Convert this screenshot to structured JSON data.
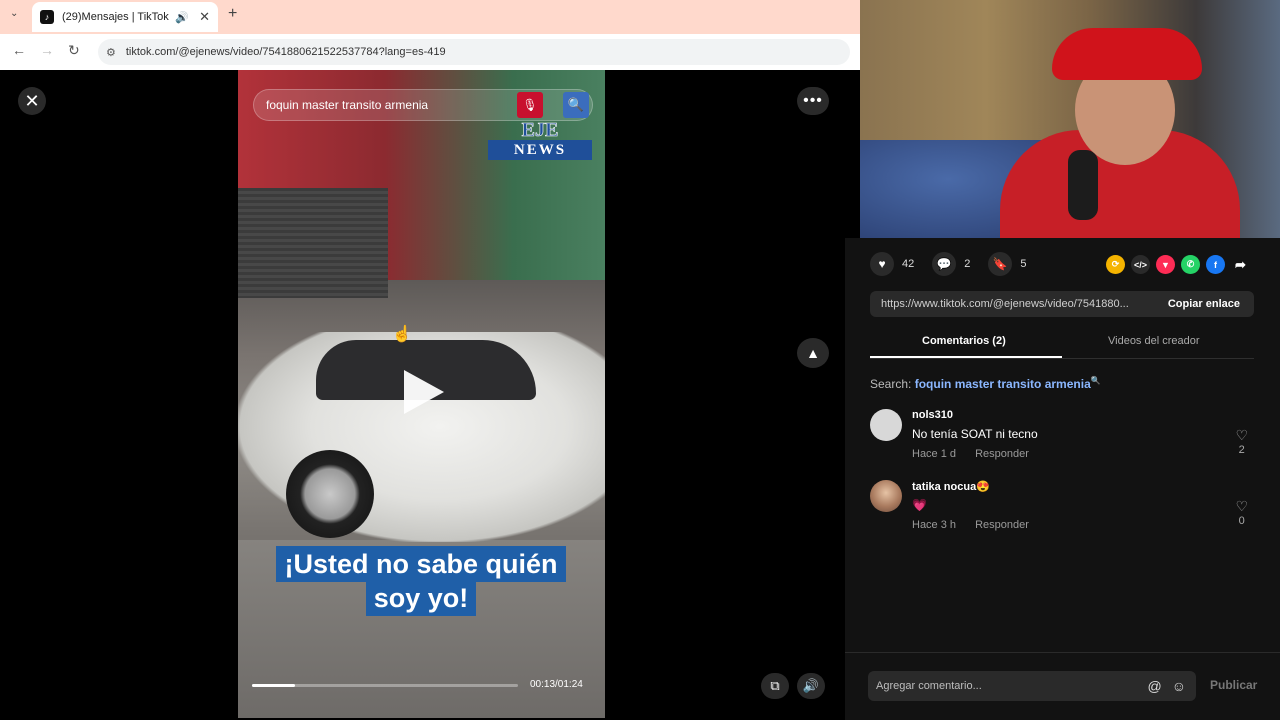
{
  "browser": {
    "tab_title": "(29)Mensajes | TikTok",
    "url": "tiktok.com/@ejenews/video/7541880621522537784?lang=es-419"
  },
  "video": {
    "overlay_search": "foquin master transito armenia",
    "brand_line1": "EJE",
    "brand_line2": "NEWS",
    "caption_line1": "¡Usted no sabe quién",
    "caption_line2": "soy yo!",
    "time": "00:13/01:24",
    "progress_fraction": 0.16
  },
  "stats": {
    "likes": "42",
    "comments": "2",
    "saves": "5"
  },
  "link": {
    "url": "https://www.tiktok.com/@ejenews/video/7541880...",
    "copy_label": "Copiar enlace"
  },
  "tabs": {
    "comments": "Comentarios (2)",
    "creator_videos": "Videos del creador"
  },
  "search": {
    "prefix": "Search:",
    "keyword": "foquin master transito armenia"
  },
  "comments": [
    {
      "user": "nols310",
      "text": "No tenía SOAT ni tecno",
      "time": "Hace 1 d",
      "reply": "Responder",
      "likes": "2"
    },
    {
      "user": "tatika nocua😍",
      "text": "💗",
      "time": "Hace 3 h",
      "reply": "Responder",
      "likes": "0"
    }
  ],
  "composer": {
    "placeholder": "Agregar comentario...",
    "publish": "Publicar"
  },
  "colors": {
    "caption_bg": "#1f5fa8",
    "brand_blue": "#1f4f99",
    "search_keyword": "#8bb7ff"
  }
}
